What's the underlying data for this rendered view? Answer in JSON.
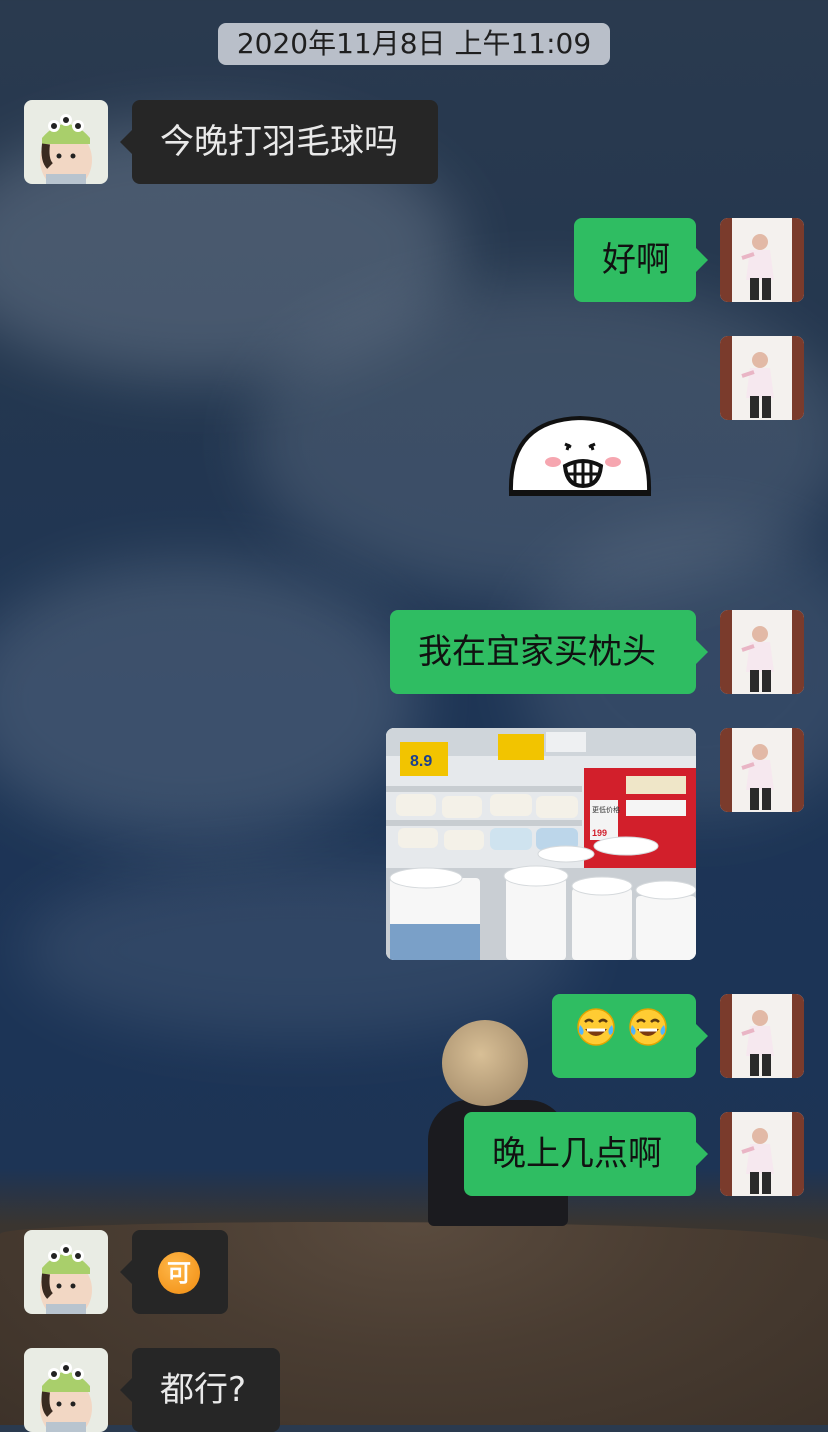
{
  "timestamp": "2020年11月8日 上午11:09",
  "messages": [
    {
      "side": "left",
      "text": "今晚打羽毛球吗"
    },
    {
      "side": "right",
      "text": "好啊"
    },
    {
      "side": "right",
      "type": "sticker",
      "sticker": "grinning-bun-sticker"
    },
    {
      "side": "right",
      "text": "我在宜家买枕头"
    },
    {
      "side": "right",
      "type": "image",
      "image": "ikea-pillow-aisle-photo",
      "image_texts": [
        "8.9",
        "更低价格",
        "199"
      ]
    },
    {
      "side": "right",
      "type": "emoji",
      "emoji": [
        "😂",
        "😂"
      ]
    },
    {
      "side": "right",
      "text": "晚上几点啊"
    },
    {
      "side": "left",
      "type": "emoji",
      "badge": "可"
    },
    {
      "side": "left",
      "text": "都行?"
    }
  ],
  "colors": {
    "sent_bubble": "#2fbd62",
    "received_bubble": "#262626",
    "timestamp_bg": "#d2d7de"
  }
}
